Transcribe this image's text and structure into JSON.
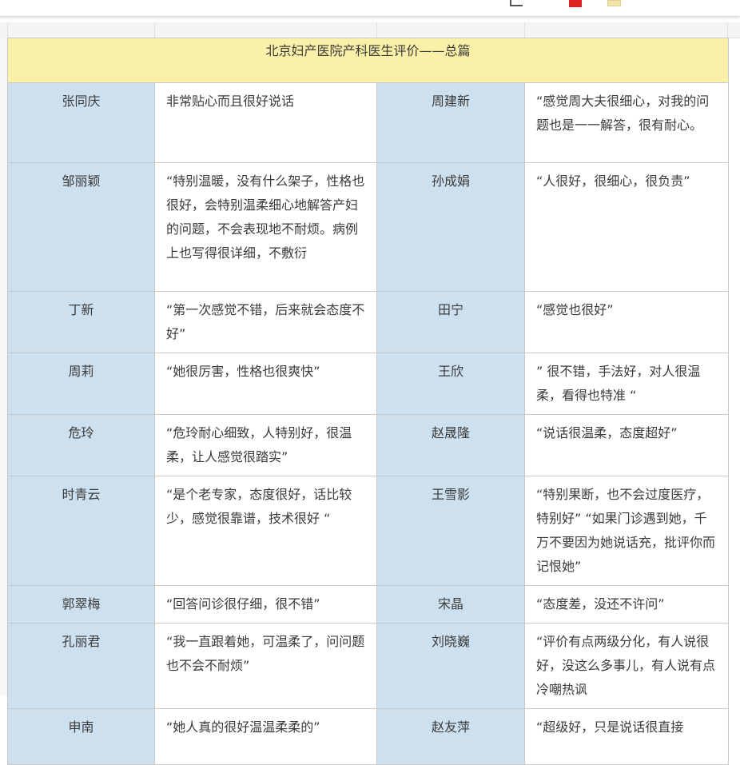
{
  "title": "北京妇产医院产科医生评价——总篇",
  "rows": [
    {
      "name_a": "张同庆",
      "comment_a": "非常贴心而且很好说话",
      "name_b": "周建新",
      "comment_b": "“感觉周大夫很细心，对我的问题也是一一解答，很有耐心。"
    },
    {
      "name_a": "邹丽颖",
      "comment_a": "“特别温暖，没有什么架子，性格也很好，会特别温柔细心地解答产妇的问题，不会表现地不耐烦。病例上也写得很详细，不敷衍",
      "name_b": "孙成娟",
      "comment_b": "“人很好，很细心，很负责”"
    },
    {
      "name_a": "丁新",
      "comment_a": "“第一次感觉不错，后来就会态度不好”",
      "name_b": "田宁",
      "comment_b": "“感觉也很好”"
    },
    {
      "name_a": "周莉",
      "comment_a": "“她很厉害，性格也很爽快”",
      "name_b": "王欣",
      "comment_b": "” 很不错，手法好，对人很温柔，看得也特准 “"
    },
    {
      "name_a": "危玲",
      "comment_a": "“危玲耐心细致，人特别好，很温柔，让人感觉很踏实”",
      "name_b": "赵晟隆",
      "comment_b": "“说话很温柔，态度超好”"
    },
    {
      "name_a": "时青云",
      "comment_a": "“是个老专家，态度很好，话比较少，感觉很靠谱，技术很好 “",
      "name_b": "王雪影",
      "comment_b": "“特别果断，也不会过度医疗，特别好” “如果门诊遇到她，千万不要因为她说话充，批评你而记恨她”"
    },
    {
      "name_a": "郭翠梅",
      "comment_a": "“回答问诊很仔细，很不错”",
      "name_b": "宋晶",
      "comment_b": "“态度差，没还不许问”"
    },
    {
      "name_a": "孔丽君",
      "comment_a": "“我一直跟着她，可温柔了，问问题也不会不耐烦”",
      "name_b": "刘晓巍",
      "comment_b": "“评价有点两级分化，有人说很好，没这么多事儿，有人说有点冷嘲热讽"
    },
    {
      "name_a": "申南",
      "comment_a": "“她人真的很好温温柔柔的”",
      "name_b": "赵友萍",
      "comment_b": "“超级好，只是说话很直接"
    }
  ]
}
